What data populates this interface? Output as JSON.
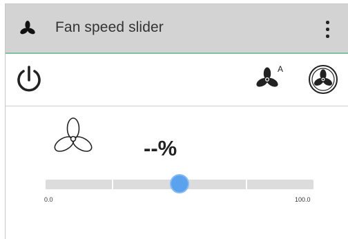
{
  "header": {
    "title": "Fan speed slider",
    "icon": "fan-icon",
    "menu_icon": "vertical-dots-icon"
  },
  "toolbar": {
    "power_icon": "power-icon",
    "fan_auto_icon": "fan-auto-icon",
    "fan_auto_badge": "A",
    "fan_circle_icon": "fan-circle-icon"
  },
  "main": {
    "fan_icon": "fan-outline-icon",
    "percent_text": "--%",
    "slider": {
      "value": 50,
      "min_label": "0.0",
      "max_label": "100.0",
      "tick_fractions": [
        0.25,
        0.5,
        0.75
      ]
    }
  },
  "colors": {
    "header_bg": "#d3d3d3",
    "accent_border": "#7fc29d",
    "slider_thumb": "#5aa2ee",
    "track": "#dcdcdc"
  }
}
